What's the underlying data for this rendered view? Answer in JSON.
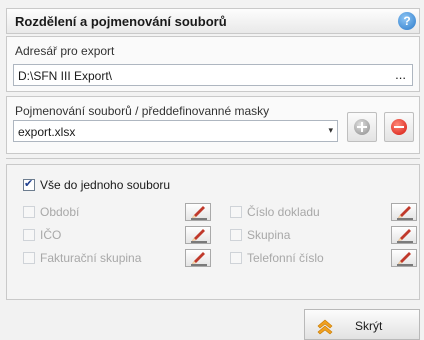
{
  "header": {
    "title": "Rozdělení a pojmenování souborů",
    "help_icon": "?"
  },
  "export_dir": {
    "label": "Adresář pro export",
    "value": "D:\\SFN III Export\\",
    "browse": "..."
  },
  "naming": {
    "label": "Pojmenování souborů / předdefinovanné masky",
    "value": "export.xlsx",
    "arrow": "▾"
  },
  "all_in_one": {
    "label": "Vše do jednoho souboru",
    "checked": true
  },
  "options": {
    "period": "Období",
    "ico": "IČO",
    "billing_group": "Fakturační skupina",
    "doc_number": "Číslo dokladu",
    "group": "Skupina",
    "phone": "Telefonní číslo"
  },
  "footer": {
    "hide_label": "Skrýt"
  }
}
